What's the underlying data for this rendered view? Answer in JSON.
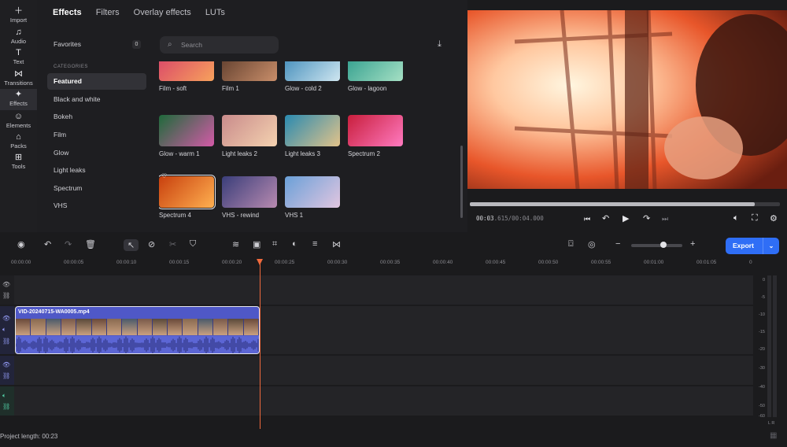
{
  "sidebar": {
    "items": [
      {
        "label": "Import",
        "icon": "plus-icon"
      },
      {
        "label": "Audio",
        "icon": "music-note-icon"
      },
      {
        "label": "Text",
        "icon": "text-t-icon"
      },
      {
        "label": "Transitions",
        "icon": "bowtie-icon"
      },
      {
        "label": "Effects",
        "icon": "sparkle-icon",
        "active": true
      },
      {
        "label": "Elements",
        "icon": "smiley-icon"
      },
      {
        "label": "Packs",
        "icon": "bag-icon"
      },
      {
        "label": "Tools",
        "icon": "grid-icon"
      }
    ]
  },
  "panel": {
    "tabs": [
      "Effects",
      "Filters",
      "Overlay effects",
      "LUTs"
    ],
    "favorites": {
      "label": "Favorites",
      "count": "0"
    },
    "categories_label": "CATEGORIES",
    "categories": [
      "Featured",
      "Black and white",
      "Bokeh",
      "Film",
      "Glow",
      "Light leaks",
      "Spectrum",
      "VHS"
    ],
    "search_placeholder": "Search",
    "effects": [
      {
        "label": "Film - soft",
        "c1": "#d8406a",
        "c2": "#f7a25c"
      },
      {
        "label": "Film 1",
        "c1": "#5a3a2a",
        "c2": "#c98e6a"
      },
      {
        "label": "Glow - cold 2",
        "c1": "#3a87b7",
        "c2": "#cfe6f0"
      },
      {
        "label": "Glow - lagoon",
        "c1": "#2a9a8a",
        "c2": "#a6e0c4"
      },
      {
        "label": "Glow - warm 1",
        "c1": "#1e6a3a",
        "c2": "#d45aa8"
      },
      {
        "label": "Light leaks 2",
        "c1": "#c98b8b",
        "c2": "#f4d2b0"
      },
      {
        "label": "Light leaks 3",
        "c1": "#2a8ab0",
        "c2": "#e2c38a"
      },
      {
        "label": "Spectrum 2",
        "c1": "#c81e3c",
        "c2": "#ff7ac0"
      },
      {
        "label": "Spectrum 4",
        "c1": "#c8400e",
        "c2": "#ffb050"
      },
      {
        "label": "VHS - rewind",
        "c1": "#3a3e7a",
        "c2": "#b88ab0"
      },
      {
        "label": "VHS 1",
        "c1": "#6aa0d8",
        "c2": "#e2c6e0"
      }
    ]
  },
  "player": {
    "timecode_current": "00:03",
    "timecode_frames": ".615",
    "timecode_total": "/00:04.000",
    "progress": 0.92
  },
  "toolbar": {
    "export_label": "Export"
  },
  "timeline": {
    "ruler": [
      "00:00:00",
      "00:00:05",
      "00:00:10",
      "00:00:15",
      "00:00:20",
      "00:00:25",
      "00:00:30",
      "00:00:35",
      "00:00:40",
      "00:00:45",
      "00:00:50",
      "00:00:55",
      "00:01:00",
      "00:01:05",
      "0"
    ],
    "clip_name": "VID-20240715-WA0005.mp4",
    "meter_labels": [
      "0",
      "-5",
      "-10",
      "-15",
      "-20",
      "-30",
      "-40",
      "-50",
      "-60"
    ],
    "meter_lr": "L  R",
    "project_length": "Project length: 00:23"
  },
  "colors": {
    "accent": "#2f6ef6",
    "playhead": "#f06a3d",
    "clip": "#4f58c7"
  }
}
